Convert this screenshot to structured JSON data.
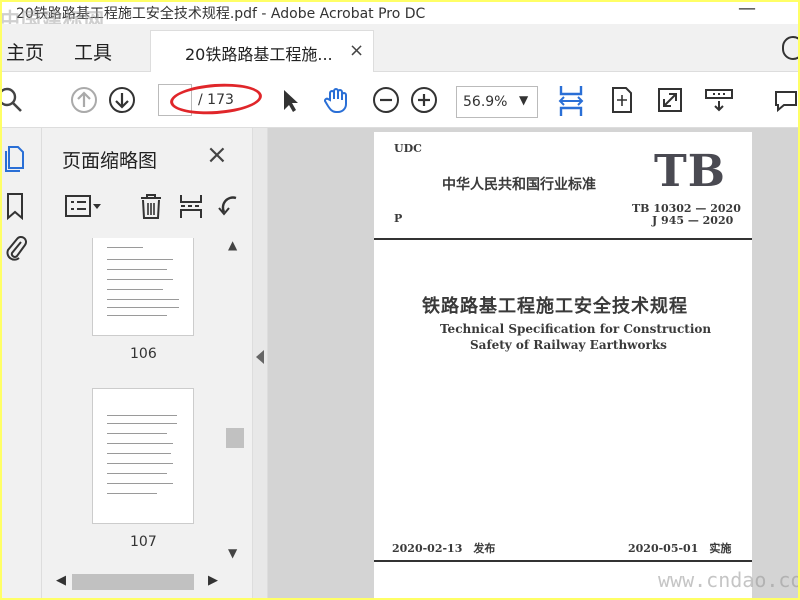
{
  "window": {
    "title": "20铁路路基工程施工安全技术规程.pdf - Adobe Acrobat Pro DC",
    "watermark_top_left": "中国建标网"
  },
  "tabs": {
    "home": "主页",
    "tools": "工具",
    "document": "20铁路路基工程施...",
    "close_symbol": "×"
  },
  "toolbar": {
    "page_total": "/ 173",
    "page_value": "",
    "zoom": "56.9%"
  },
  "panel": {
    "title": "页面缩略图",
    "thumbnails": [
      {
        "page": "106"
      },
      {
        "page": "107"
      }
    ]
  },
  "document": {
    "udc": "UDC",
    "org": "中华人民共和国行业标准",
    "tb": "TB",
    "classification": "P",
    "code1": "TB 10302 — 2020",
    "code2": "J 945 — 2020",
    "title_cn": "铁路路基工程施工安全技术规程",
    "title_en_1": "Technical Specification for Construction",
    "title_en_2": "Safety of Railway Earthworks",
    "issue": "2020-02-13　发布",
    "implement": "2020-05-01　实施"
  },
  "watermark_bottom_right": "www.cndao.com",
  "colors": {
    "accent": "#2a6fd6",
    "annotation": "#e0262a",
    "highlight_border": "#ffff66"
  }
}
